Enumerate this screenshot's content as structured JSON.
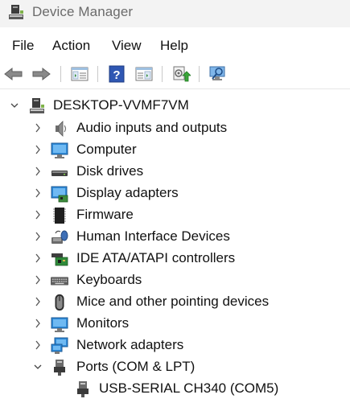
{
  "window": {
    "title": "Device Manager",
    "icon": "device-manager-icon"
  },
  "menu": [
    {
      "label": "File"
    },
    {
      "label": "Action"
    },
    {
      "label": "View"
    },
    {
      "label": "Help"
    }
  ],
  "toolbar": [
    {
      "icon": "back-arrow-icon"
    },
    {
      "icon": "forward-arrow-icon"
    },
    {
      "icon": "show-hide-console-tree-icon"
    },
    {
      "icon": "help-icon"
    },
    {
      "icon": "properties-pane-icon"
    },
    {
      "icon": "update-driver-icon"
    },
    {
      "icon": "scan-hardware-changes-icon"
    }
  ],
  "tree": {
    "root": {
      "label": "DESKTOP-VVMF7VM",
      "expanded": true,
      "icon": "computer-tower-icon"
    },
    "categories": [
      {
        "label": "Audio inputs and outputs",
        "icon": "speaker-icon",
        "expanded": false
      },
      {
        "label": "Computer",
        "icon": "monitor-icon",
        "expanded": false
      },
      {
        "label": "Disk drives",
        "icon": "disk-drive-icon",
        "expanded": false
      },
      {
        "label": "Display adapters",
        "icon": "display-adapter-icon",
        "expanded": false
      },
      {
        "label": "Firmware",
        "icon": "chip-icon",
        "expanded": false
      },
      {
        "label": "Human Interface Devices",
        "icon": "hid-icon",
        "expanded": false
      },
      {
        "label": "IDE ATA/ATAPI controllers",
        "icon": "ide-controller-icon",
        "expanded": false
      },
      {
        "label": "Keyboards",
        "icon": "keyboard-icon",
        "expanded": false
      },
      {
        "label": "Mice and other pointing devices",
        "icon": "mouse-icon",
        "expanded": false
      },
      {
        "label": "Monitors",
        "icon": "monitor-icon",
        "expanded": false
      },
      {
        "label": "Network adapters",
        "icon": "network-adapter-icon",
        "expanded": false
      },
      {
        "label": "Ports (COM & LPT)",
        "icon": "port-plug-icon",
        "expanded": true,
        "children": [
          {
            "label": "USB-SERIAL CH340 (COM5)",
            "icon": "port-plug-icon"
          }
        ]
      }
    ]
  }
}
